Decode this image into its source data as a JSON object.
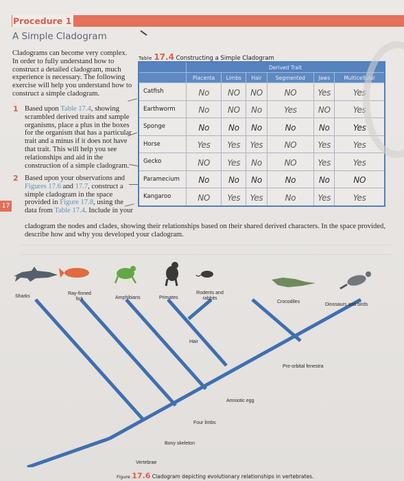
{
  "header": {
    "procedure_label": "Procedure 1",
    "section_title": "A Simple Cladogram"
  },
  "chapter_tab": "17",
  "intro_text": "Cladograms can become very complex. In order to fully understand how to construct a detailed cladogram, much experience is necessary. The following exercise will help you understand how to construct a simple cladogram.",
  "steps": [
    {
      "number": "1",
      "parts": [
        "Based upon ",
        "Table 17.4",
        ", showing scrambled derived traits and sample organisms, place a plus in the boxes for the organism that has a particular trait and a minus if it does not have that trait. This will help you see relationships and aid in the construction of a simple cladogram."
      ]
    },
    {
      "number": "2",
      "parts": [
        "Based upon your observations and ",
        "Figures 17.6",
        " and ",
        "17.7",
        ", construct a simple cladogram in the space provided in ",
        "Figure 17.8",
        ", using the data from ",
        "Table 17.4",
        ". Include in your"
      ],
      "continuation": "cladogram the nodes and clades, showing their relationships based on their shared derived characters. In the space provided, describe how and why you developed your cladogram."
    }
  ],
  "table": {
    "label": "Table",
    "number": "17.4",
    "title": "Constructing a Simple Cladogram",
    "super_header": "Derived Trait",
    "columns": [
      "Placenta",
      "Limbs",
      "Hair",
      "Segmented",
      "Jaws",
      "Multicellular"
    ],
    "rows": [
      {
        "organism": "Catfish",
        "values": [
          "No",
          "NO",
          "NO",
          "NO",
          "Yes",
          "Yes"
        ]
      },
      {
        "organism": "Earthworm",
        "values": [
          "No",
          "NO",
          "No",
          "Yes",
          "NO",
          "Yes"
        ]
      },
      {
        "organism": "Sponge",
        "values": [
          "No",
          "No",
          "No",
          "No",
          "No",
          "Yes"
        ]
      },
      {
        "organism": "Horse",
        "values": [
          "Yes",
          "Yes",
          "Yes",
          "NO",
          "Yes",
          "Yes"
        ]
      },
      {
        "organism": "Gecko",
        "values": [
          "NO",
          "Yes",
          "No",
          "NO",
          "Yes",
          "Yes"
        ]
      },
      {
        "organism": "Paramecium",
        "values": [
          "No",
          "No",
          "No",
          "No",
          "No",
          "NO"
        ]
      },
      {
        "organism": "Kangaroo",
        "values": [
          "NO",
          "Yes",
          "Yes",
          "No",
          "Yes",
          "Yes"
        ]
      }
    ]
  },
  "cladogram": {
    "taxa": [
      "Sharks",
      "Ray-finned fish",
      "Amphibians",
      "Primates",
      "Rodents and rabbits",
      "Crocodiles",
      "Dinosaurs and birds"
    ],
    "traits": [
      "Vertebrae",
      "Bony skeleton",
      "Four limbs",
      "Amniotic egg",
      "Hair",
      "Pre-orbital fenestra"
    ],
    "line_color": "#3f6fb0"
  },
  "figure": {
    "label": "Figure",
    "number": "17.6",
    "caption": "Cladogram depicting evolutionary relationships in vertebrates."
  },
  "colors": {
    "accent": "#e5705c",
    "link": "#5a93b8",
    "table_header": "#5e89c2"
  }
}
